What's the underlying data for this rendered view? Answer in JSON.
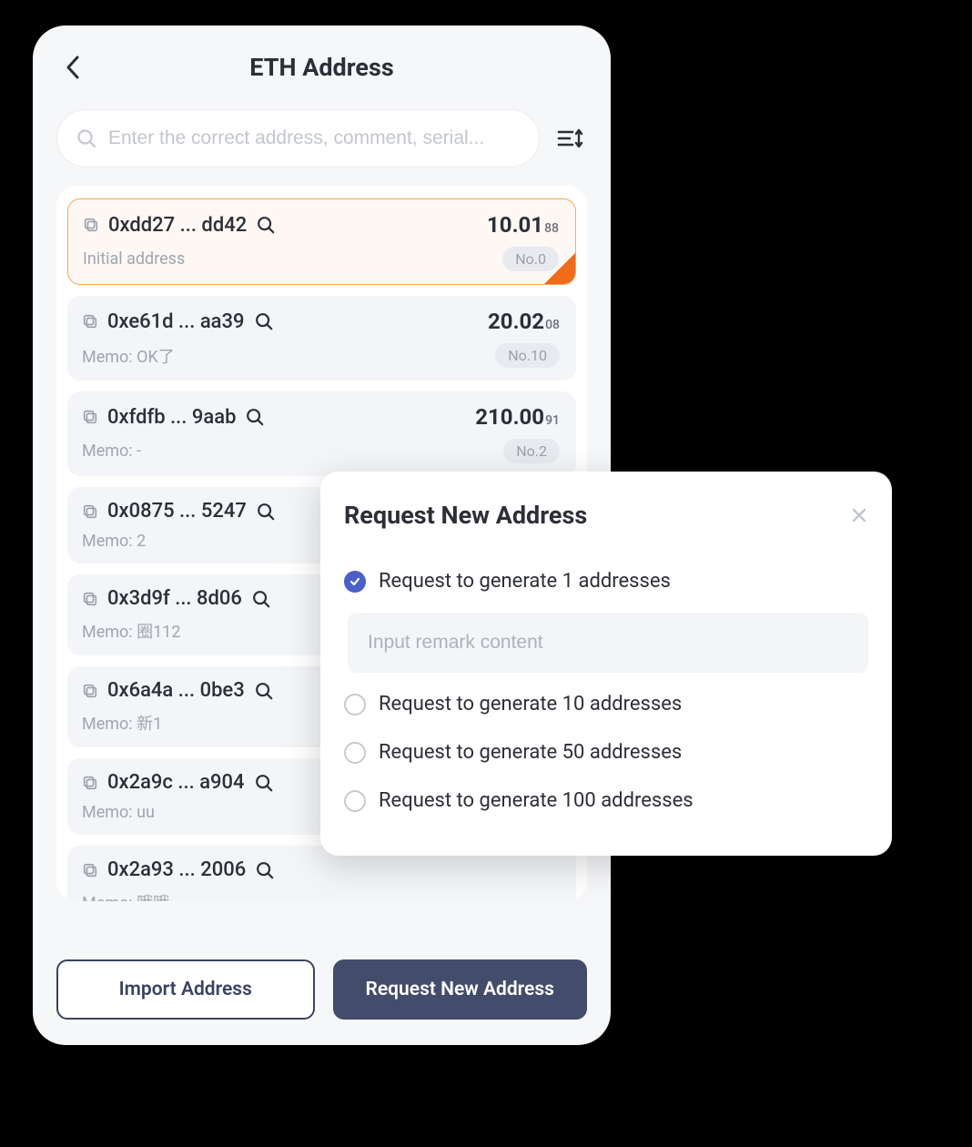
{
  "header": {
    "title": "ETH Address"
  },
  "search": {
    "placeholder": "Enter the correct address, comment, serial..."
  },
  "addresses": [
    {
      "addr": "0xdd27 ... dd42",
      "balance_main": "10.01",
      "balance_sub": "88",
      "memo": "Initial address",
      "no": "No.0",
      "selected": true
    },
    {
      "addr": "0xe61d ... aa39",
      "balance_main": "20.02",
      "balance_sub": "08",
      "memo": "Memo: OK了",
      "no": "No.10",
      "selected": false
    },
    {
      "addr": "0xfdfb ... 9aab",
      "balance_main": "210.00",
      "balance_sub": "91",
      "memo": "Memo: -",
      "no": "No.2",
      "selected": false
    },
    {
      "addr": "0x0875 ... 5247",
      "balance_main": "",
      "balance_sub": "",
      "memo": "Memo: 2",
      "no": "",
      "selected": false
    },
    {
      "addr": "0x3d9f ... 8d06",
      "balance_main": "",
      "balance_sub": "",
      "memo": "Memo: 圈112",
      "no": "",
      "selected": false
    },
    {
      "addr": "0x6a4a ... 0be3",
      "balance_main": "",
      "balance_sub": "",
      "memo": "Memo: 新1",
      "no": "",
      "selected": false
    },
    {
      "addr": "0x2a9c ... a904",
      "balance_main": "",
      "balance_sub": "",
      "memo": "Memo: uu",
      "no": "",
      "selected": false
    },
    {
      "addr": "0x2a93 ... 2006",
      "balance_main": "",
      "balance_sub": "",
      "memo": "Memo: 哦哦",
      "no": "",
      "selected": false
    }
  ],
  "buttons": {
    "import": "Import Address",
    "request": "Request New Address"
  },
  "modal": {
    "title": "Request New Address",
    "remark_placeholder": "Input remark content",
    "options": [
      {
        "label": "Request to generate 1 addresses",
        "checked": true
      },
      {
        "label": "Request to generate 10 addresses",
        "checked": false
      },
      {
        "label": "Request to generate 50 addresses",
        "checked": false
      },
      {
        "label": "Request to generate 100 addresses",
        "checked": false
      }
    ]
  }
}
